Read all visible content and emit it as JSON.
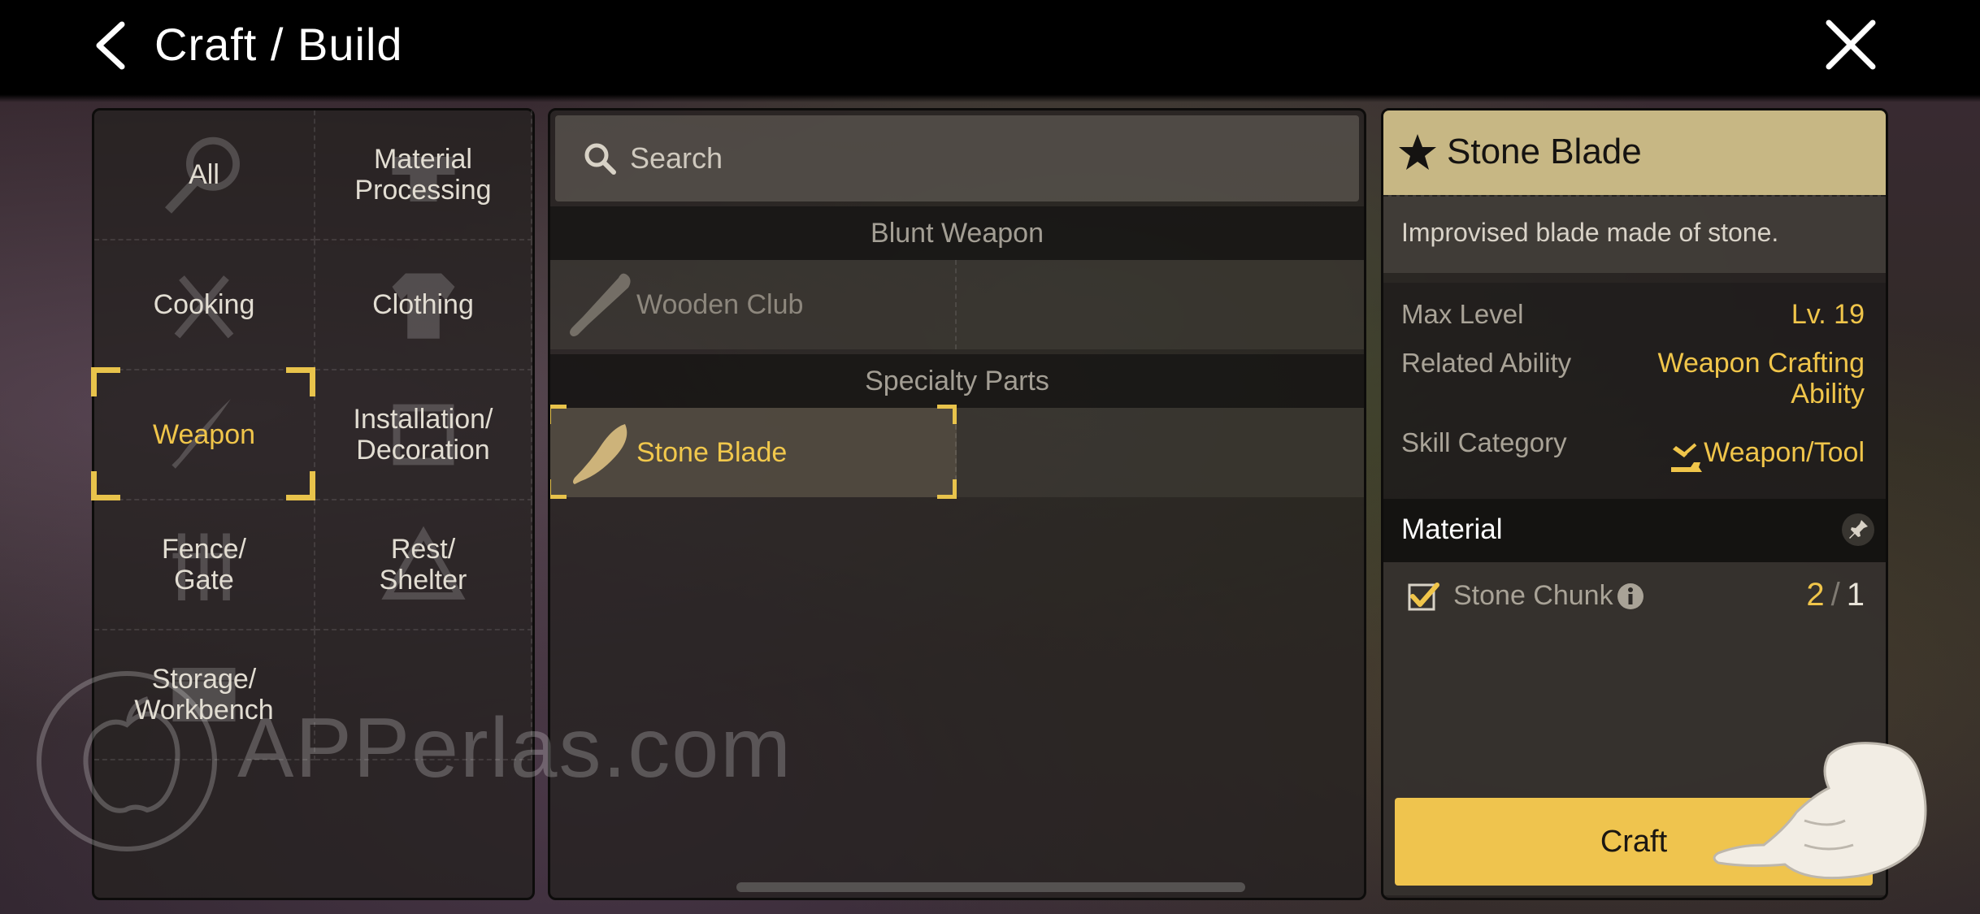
{
  "header": {
    "title": "Craft / Build"
  },
  "categories": [
    {
      "label": "All",
      "icon": "magnifier-icon"
    },
    {
      "label": "Material\nProcessing",
      "icon": "anvil-icon"
    },
    {
      "label": "Cooking",
      "icon": "utensils-icon"
    },
    {
      "label": "Clothing",
      "icon": "shirt-icon"
    },
    {
      "label": "Weapon",
      "icon": "blade-icon",
      "selected": true
    },
    {
      "label": "Installation/\nDecoration",
      "icon": "frame-icon"
    },
    {
      "label": "Fence/\nGate",
      "icon": "fence-icon"
    },
    {
      "label": "Rest/\nShelter",
      "icon": "tent-icon"
    },
    {
      "label": "Storage/\nWorkbench",
      "icon": "chest-icon"
    },
    {
      "label": "",
      "icon": ""
    }
  ],
  "search": {
    "placeholder": "Search"
  },
  "groups": [
    {
      "header": "Blunt Weapon",
      "items": [
        {
          "label": "Wooden Club",
          "icon": "club-icon",
          "state": "dim"
        }
      ]
    },
    {
      "header": "Specialty Parts",
      "items": [
        {
          "label": "Stone Blade",
          "icon": "stone-blade-icon",
          "state": "selected"
        }
      ]
    }
  ],
  "detail": {
    "name": "Stone Blade",
    "description": "Improvised blade made of stone.",
    "stats": [
      {
        "label": "Max Level",
        "value": "Lv. 19"
      },
      {
        "label": "Related Ability",
        "value": "Weapon Crafting\nAbility"
      },
      {
        "label": "Skill Category",
        "value": "Weapon/Tool"
      }
    ],
    "material_title": "Material",
    "materials": [
      {
        "name": "Stone Chunk",
        "have": "2",
        "separator": "/",
        "need": "1"
      }
    ],
    "craft_label": "Craft"
  },
  "watermark": {
    "text": "APPerlas.com"
  },
  "colors": {
    "accent": "#f0c54a",
    "header_gold": "#c7b784",
    "button": "#efc44e"
  }
}
